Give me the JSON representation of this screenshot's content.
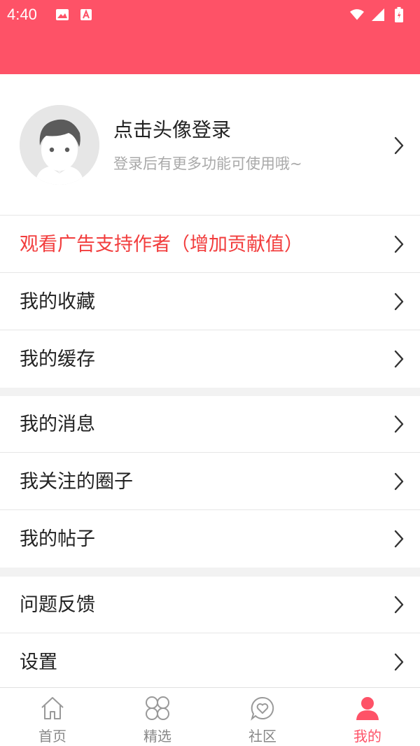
{
  "status_bar": {
    "time": "4:40",
    "icons": [
      "image-icon",
      "app-icon",
      "wifi-icon",
      "signal-icon",
      "battery-icon"
    ],
    "background": "#fe5267"
  },
  "profile": {
    "name": "点击头像登录",
    "subtitle": "登录后有更多功能可使用哦~",
    "avatar_icon": "default-avatar-icon"
  },
  "menu": {
    "ad": "观看广告支持作者（增加贡献值）",
    "favorites": "我的收藏",
    "cache": "我的缓存",
    "messages": "我的消息",
    "followed_circles": "我关注的圈子",
    "posts": "我的帖子",
    "feedback": "问题反馈",
    "settings": "设置"
  },
  "tabs": [
    {
      "label": "首页",
      "icon": "home-icon",
      "active": false
    },
    {
      "label": "精选",
      "icon": "grid-icon",
      "active": false
    },
    {
      "label": "社区",
      "icon": "community-icon",
      "active": false
    },
    {
      "label": "我的",
      "icon": "profile-icon",
      "active": true
    }
  ],
  "colors": {
    "accent": "#fe5267",
    "highlight_text": "#f23d3d",
    "divider": "#e6e6e6",
    "section_gap": "#f2f2f2"
  }
}
